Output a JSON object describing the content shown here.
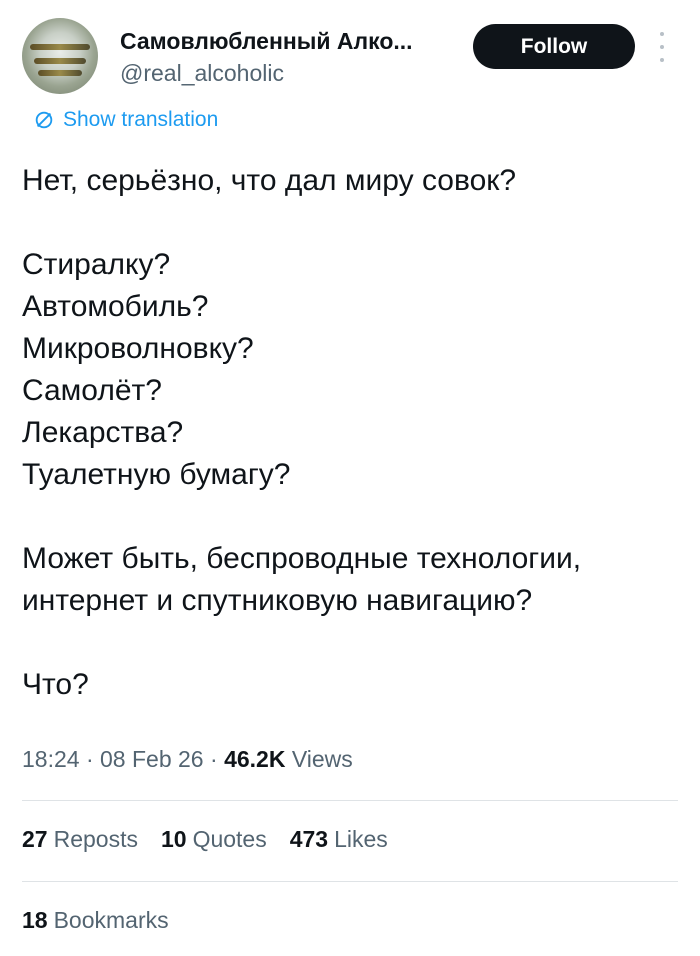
{
  "colors": {
    "accent": "#1d9bf0",
    "text": "#0f1419",
    "muted": "#536471",
    "follow_bg": "#0f1419"
  },
  "author": {
    "display_name": "Самовлюбленный Алко...",
    "handle": "@real_alcoholic",
    "avatar_icon": "avatar-photo"
  },
  "actions": {
    "follow_label": "Follow",
    "more_icon": "more-vertical-icon"
  },
  "translation": {
    "label": "Show translation",
    "icon": "globe-icon"
  },
  "tweet": {
    "paragraphs": [
      [
        "Нет, серьёзно, что дал миру совок?"
      ],
      [
        "Стиралку?",
        "Автомобиль?",
        "Микроволновку?",
        "Самолёт?",
        "Лекарства?",
        "Туалетную бумагу?"
      ],
      [
        "Может быть, беспроводные технологии,",
        "интернет и спутниковую навигацию?"
      ],
      [
        "Что?"
      ]
    ]
  },
  "meta": {
    "time": "18:24",
    "date": "08 Feb 26",
    "views_count": "46.2K",
    "views_label": "Views",
    "separator": "·"
  },
  "stats": {
    "reposts_count": "27",
    "reposts_label": "Reposts",
    "quotes_count": "10",
    "quotes_label": "Quotes",
    "likes_count": "473",
    "likes_label": "Likes",
    "bookmarks_count": "18",
    "bookmarks_label": "Bookmarks"
  }
}
